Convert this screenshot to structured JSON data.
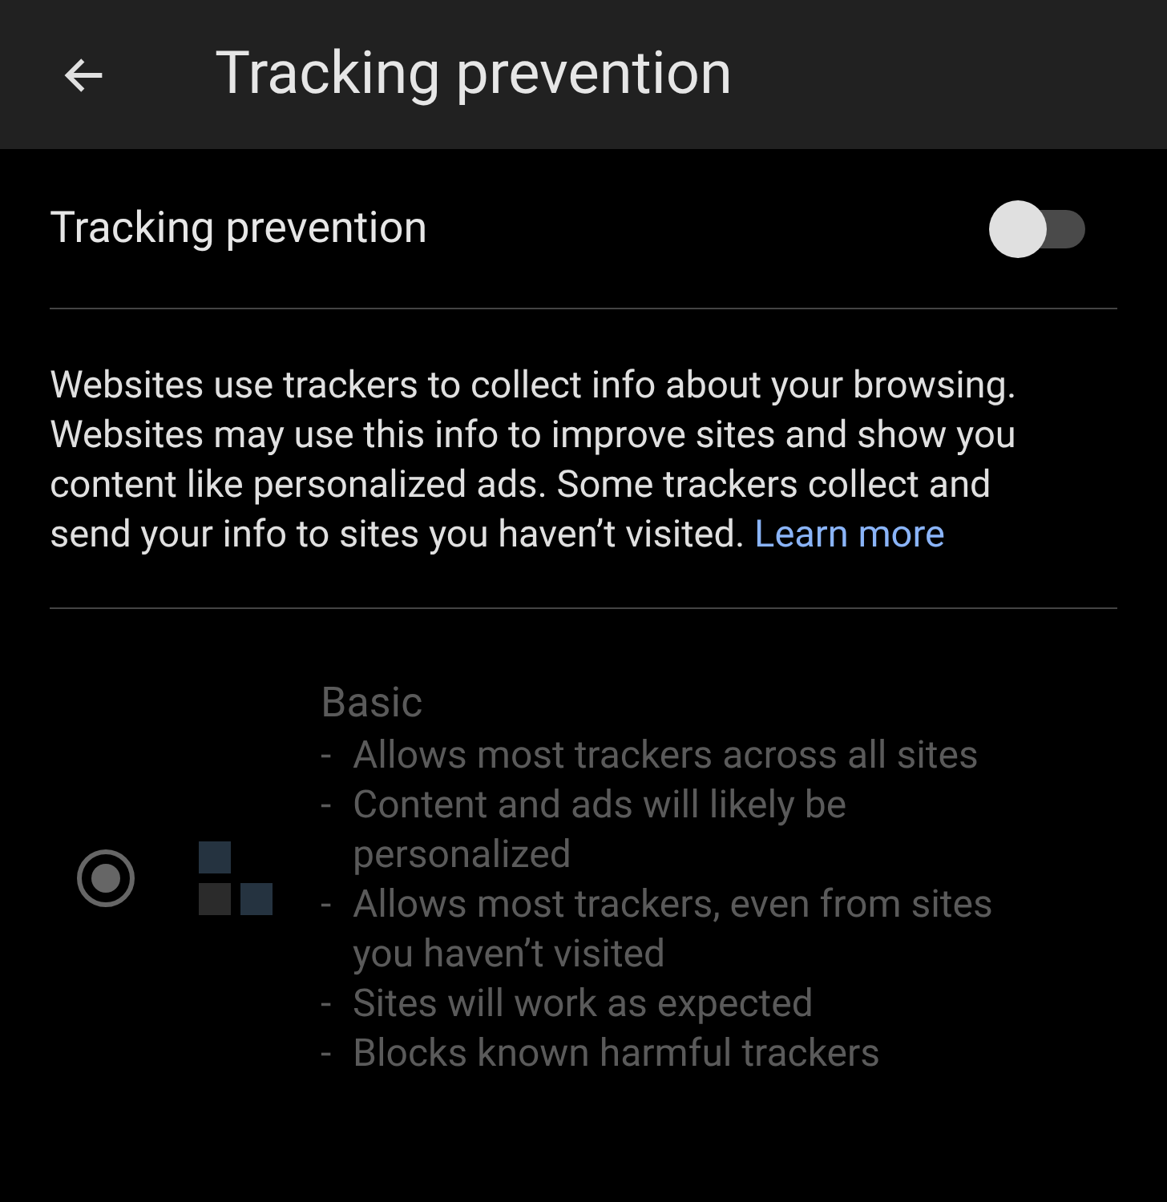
{
  "app_bar": {
    "title": "Tracking prevention"
  },
  "setting": {
    "label": "Tracking prevention",
    "on": false
  },
  "description": {
    "text": "Websites use trackers to collect info about your browsing. Websites may use this info to improve sites and show you content like personalized ads. Some trackers collect and send your info to sites you haven’t visited.",
    "link": "Learn more"
  },
  "options": [
    {
      "title": "Basic",
      "selected": true,
      "disabled": true,
      "points": [
        {
          "marker": "-",
          "text": "Allows most trackers across all sites"
        },
        {
          "marker": "-",
          "text": "Content and ads will likely be personalized"
        },
        {
          "marker": "-",
          "text": "Allows most trackers, even from sites you haven’t visited"
        },
        {
          "marker": "-",
          "text": "Sites will work as expected"
        },
        {
          "marker": "-",
          "text": "Blocks known harmful trackers"
        }
      ]
    }
  ]
}
